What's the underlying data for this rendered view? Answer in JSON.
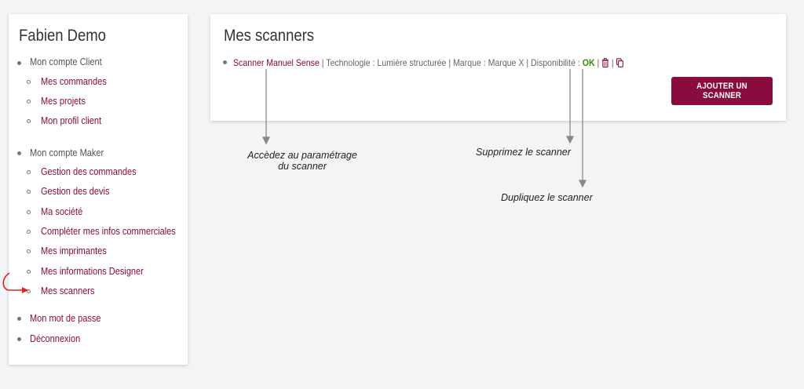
{
  "sidebar": {
    "title": "Fabien Demo",
    "client_section": "Mon compte Client",
    "client_items": [
      "Mes commandes",
      "Mes projets",
      "Mon profil client"
    ],
    "maker_section": "Mon compte Maker",
    "maker_items": [
      "Gestion des commandes",
      "Gestion des devis",
      "Ma société",
      "Compléter mes infos commerciales",
      "Mes imprimantes",
      "Mes informations Designer",
      "Mes scanners"
    ],
    "password": "Mon mot de passe",
    "logout": "Déconnexion"
  },
  "main": {
    "title": "Mes scanners",
    "scanner": {
      "name": "Scanner Manuel Sense",
      "details": " | Technologie : Lumière structurée | Marque : Marque X | Disponibilité : ",
      "status": "OK",
      "sep1": " | ",
      "sep2": " |"
    },
    "add_button": "AJOUTER UN SCANNER"
  },
  "annotations": {
    "settings_line1": "Accèdez au paramétrage",
    "settings_line2": "du scanner",
    "delete": "Supprimez le scanner",
    "duplicate": "Dupliquez le scanner"
  },
  "icons": {
    "delete": "trash-icon",
    "duplicate": "copy-icon",
    "arrow": "red-arrow-icon"
  },
  "colors": {
    "accent": "#8a0b3e",
    "ok": "#3a8a10",
    "annotation_arrow": "#888888",
    "pointer_arrow": "#e02020"
  }
}
